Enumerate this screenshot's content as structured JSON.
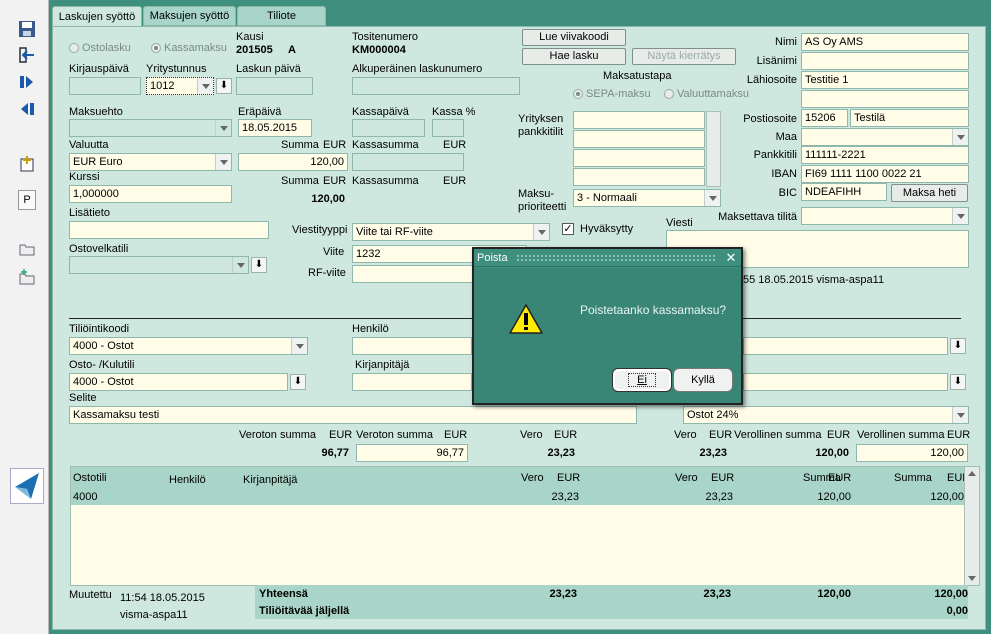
{
  "tabs": [
    "Laskujen syöttö",
    "Maksujen syöttö",
    "Tiliote"
  ],
  "toolbar_p": "P",
  "form": {
    "ostolasku": "Ostolasku",
    "kassamaksu": "Kassamaksu",
    "kausi_label": "Kausi",
    "kausi_value": "201505",
    "kausi_letter": "A",
    "tositenumero_label": "Tositenumero",
    "tositenumero_value": "KM000004",
    "kirjauspaiva": "Kirjauspäivä",
    "yritystunnus": "Yritystunnus",
    "yritystunnus_value": "1012",
    "laskun_paiva": "Laskun päivä",
    "alkup_label": "Alkuperäinen laskunumero",
    "maksuehto": "Maksuehto",
    "erapaiva": "Eräpäivä",
    "erapaiva_value": "18.05.2015",
    "kassapaiva": "Kassapäivä",
    "kassa_pct": "Kassa %",
    "valuutta": "Valuutta",
    "valuutta_value": "EUR Euro",
    "summa": "Summa",
    "eur": "EUR",
    "summa_value": "120,00",
    "kassasumma": "Kassasumma",
    "kurssi": "Kurssi",
    "kurssi_value": "1,000000",
    "summa_static": "120,00",
    "lisatieto": "Lisätieto",
    "ostovelkatili": "Ostovelkatili",
    "viestityyppi": "Viestityyppi",
    "viestityyppi_value": "Viite tai RF-viite",
    "viite": "Viite",
    "viite_value": "1232",
    "rf_viite": "RF-viite",
    "yrityksen": "Yrityksen",
    "pankkitilit": "pankkitilit",
    "maksu": "Maksu-",
    "prioriteetti": "prioriteetti",
    "maksuprioriteetti_value": "3 - Normaali",
    "hyvaksytty": "Hyväksytty",
    "viesti": "Viesti",
    "maksatustapa": "Maksatustapa",
    "sepa": "SEPA-maksu",
    "valuuttamaksu": "Valuuttamaksu",
    "lue_viivakoodi": "Lue viivakoodi",
    "hae_lasku": "Hae lasku",
    "nayta_kierratys": "Näytä kierrätys",
    "nimi": "Nimi",
    "nimi_value": "AS Oy AMS",
    "lisanimi": "Lisänimi",
    "lahiosoite": "Lähiosoite",
    "lahiosoite_value": "Testitie 1",
    "postiosoite": "Postiosoite",
    "postinumero_value": "15206",
    "postitoimipaikka_value": "Testilä",
    "maa": "Maa",
    "pankkitili": "Pankkitili",
    "pankkitili_value": "111111-2221",
    "iban": "IBAN",
    "iban_value": "FI69 1111 1100 0022 21",
    "bic": "BIC",
    "bic_value": "NDEAFIHH",
    "maksa_heti": "Maksa heti",
    "maksettava_tilita": "Maksettava tilitä",
    "modified_peek": "55 18.05.2015 visma-aspa11"
  },
  "lower": {
    "tiliointikoodi": "Tiliöintikoodi",
    "tiliointikoodi_value": "4000 - Ostot",
    "henkilo": "Henkilö",
    "osto_kulutili": "Osto- /Kulutili",
    "osto_kulutili_value": "4000 - Ostot",
    "kirjanpitaja": "Kirjanpitäjä",
    "selite": "Selite",
    "selite_value": "Kassamaksu testi",
    "vero_value": "Ostot 24%",
    "veroton_summa": "Veroton summa",
    "eur": "EUR",
    "veroton_static": "96,77",
    "veroton_input": "96,77",
    "vero": "Vero",
    "vero_static": "23,23",
    "vero_static2": "23,23",
    "verollinen_summa": "Verollinen summa",
    "verollinen_static": "120,00",
    "verollinen_input": "120,00"
  },
  "grid": {
    "headers": {
      "ostotili": "Ostotili",
      "henkilo": "Henkilö",
      "kirjanpitaja": "Kirjanpitäjä",
      "vero1": "Vero",
      "eur1": "EUR",
      "vero2": "Vero",
      "eur2": "EUR",
      "summa1": "Summa",
      "eur3": "EUR",
      "summa2": "Summa",
      "eur4": "EUR"
    },
    "row": {
      "ostotili": "4000",
      "vero1": "23,23",
      "vero2": "23,23",
      "summa1": "120,00",
      "summa2": "120,00"
    }
  },
  "footer": {
    "muutettu": "Muutettu",
    "time": "11:54 18.05.2015",
    "user": "visma-aspa11",
    "yhteensa": "Yhteensä",
    "tilioitavaa": "Tiliöitävää jäljellä",
    "t_vero1": "23,23",
    "t_vero2": "23,23",
    "t_summa1": "120,00",
    "t_summa2": "120,00",
    "jaljella": "0,00"
  },
  "dialog": {
    "title": "Poista",
    "message": "Poistetaanko kassamaksu?",
    "no": "Ei",
    "yes": "Kyllä"
  }
}
